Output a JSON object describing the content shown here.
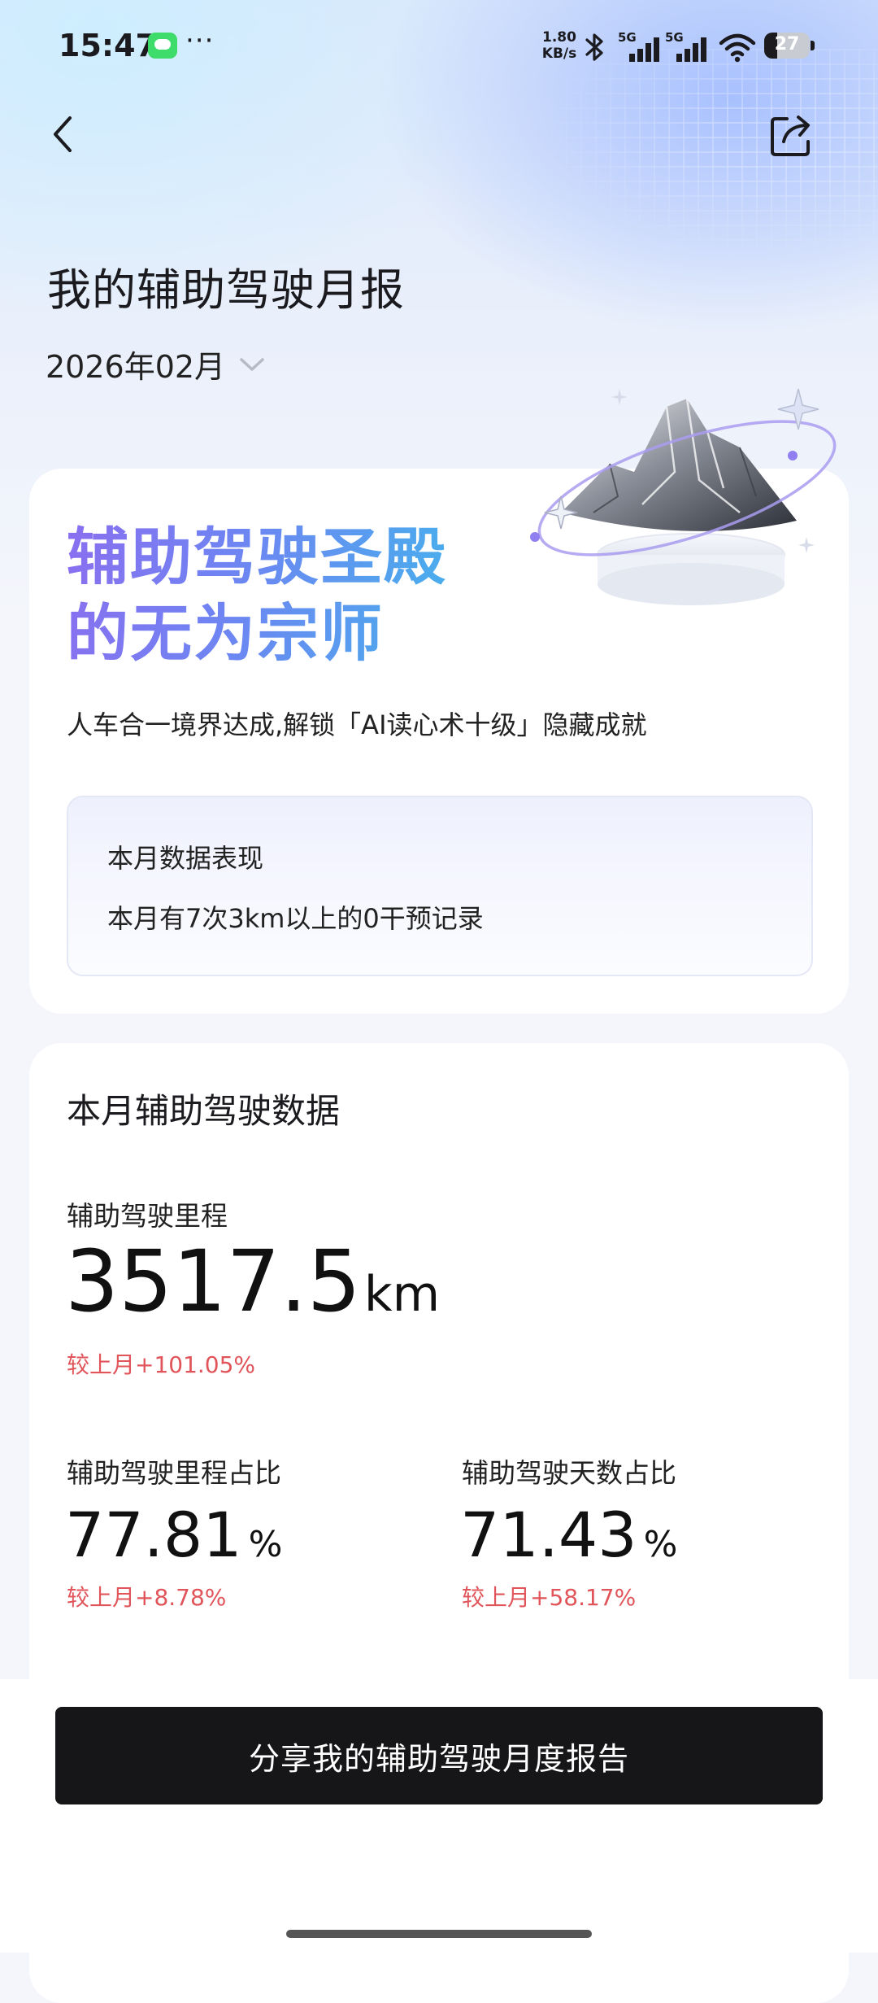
{
  "status_bar": {
    "time": "15:47",
    "more": "···",
    "net_speed_value": "1.80",
    "net_speed_unit": "KB/s",
    "signal_1_label": "5G",
    "signal_2_label": "5G",
    "battery": "27",
    "icons": [
      "message-icon",
      "bluetooth-icon",
      "signal-icon",
      "wifi-icon",
      "battery-icon"
    ]
  },
  "header": {
    "back_icon": "chevron-left-icon",
    "share_icon": "share-icon",
    "title": "我的辅助驾驶月报",
    "month": "2026年02月",
    "month_dropdown_icon": "chevron-down-icon"
  },
  "hero": {
    "title_line1": "辅助驾驶圣殿",
    "title_line2": "的无为宗师",
    "description": "人车合一境界达成,解锁「AI读心术十级」隐藏成就",
    "summary_title": "本月数据表现",
    "summary_text": "本月有7次3km以上的0干预记录",
    "gradient_colors": [
      "#8a6ff0",
      "#6d86f2",
      "#47b0ec"
    ]
  },
  "stats": {
    "title": "本月辅助驾驶数据",
    "mileage": {
      "label": "辅助驾驶里程",
      "value": "3517.5",
      "unit": "km",
      "change": "较上月+101.05%"
    },
    "mileage_ratio": {
      "label": "辅助驾驶里程占比",
      "value": "77.81",
      "unit": "%",
      "change": "较上月+8.78%"
    },
    "days_ratio": {
      "label": "辅助驾驶天数占比",
      "value": "71.43",
      "unit": "%",
      "change": "较上月+58.17%"
    },
    "change_color": "#e0545a"
  },
  "footer": {
    "share_button": "分享我的辅助驾驶月度报告"
  }
}
